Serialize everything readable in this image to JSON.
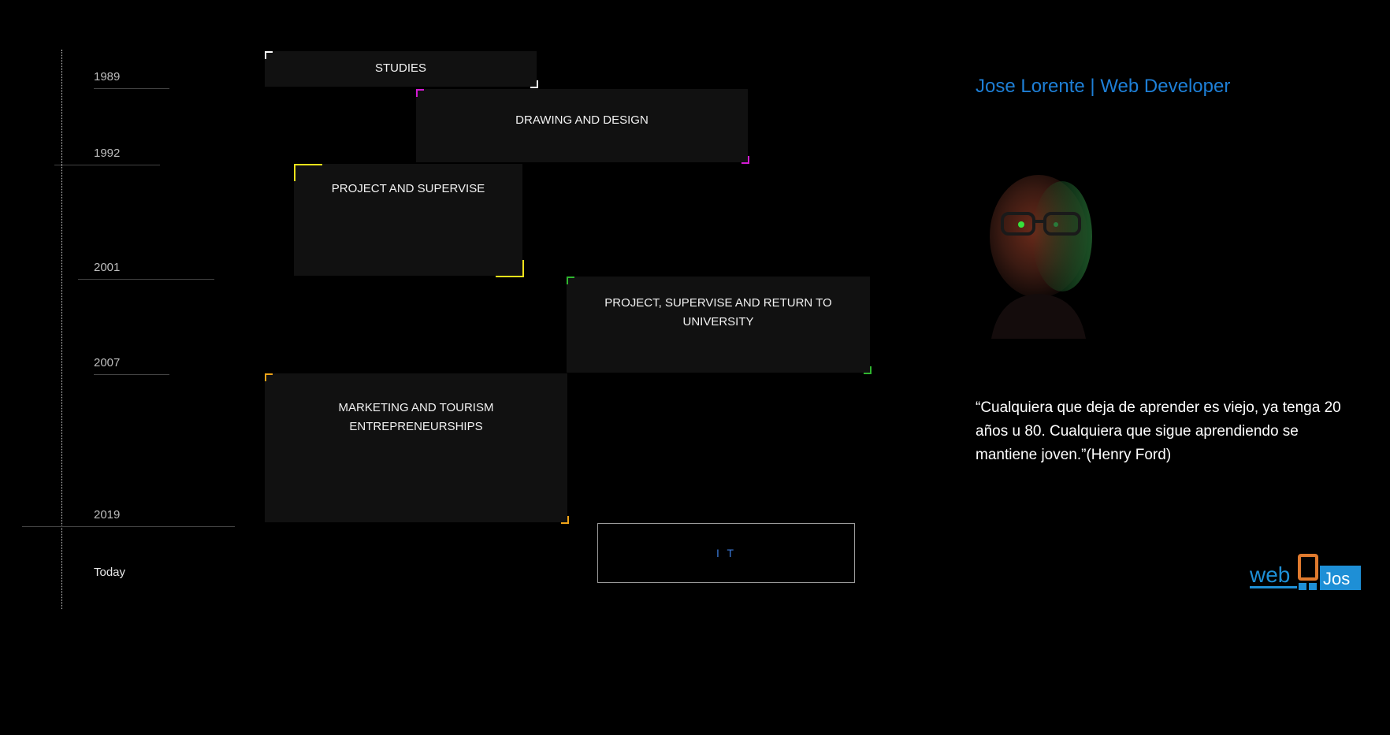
{
  "timeline": {
    "years": [
      "1989",
      "1992",
      "2001",
      "2007",
      "2019",
      "Today"
    ]
  },
  "cards": [
    {
      "title": "STUDIES",
      "accent": "#ffffff"
    },
    {
      "title": "DRAWING AND DESIGN",
      "accent": "#d21ad2"
    },
    {
      "title": "PROJECT AND SUPERVISE",
      "accent": "#f2e21a"
    },
    {
      "title": "PROJECT, SUPERVISE AND RETURN TO UNIVERSITY",
      "accent": "#2fb52f"
    },
    {
      "title": "MARKETING AND TOURISM ENTREPRENEURSHIPS",
      "accent": "#f0a418"
    },
    {
      "title": "I T",
      "accent": "#3b7ad9"
    }
  ],
  "profile": {
    "title": "Jose Lorente | Web Developer",
    "quote": "“Cualquiera que deja de aprender es viejo, ya tenga 20 años u 80. Cualquiera que sigue aprendiendo se mantiene joven.”(Henry Ford)",
    "portrait_icon": "person-portrait"
  },
  "logo": {
    "part1": "web",
    "part2": "D",
    "part3": "Jos"
  },
  "colors": {
    "background": "#000000",
    "accent_blue": "#1e7fd6",
    "logo_orange": "#e07a2e"
  }
}
